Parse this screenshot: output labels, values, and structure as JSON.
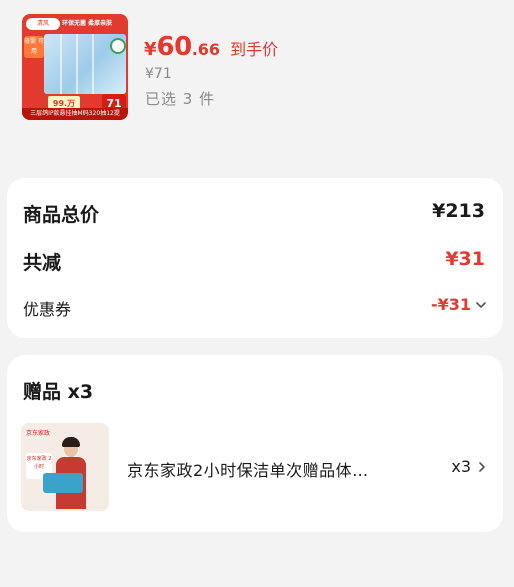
{
  "product": {
    "thumb": {
      "logo": "清风",
      "slogan": "环保无菌  柔厚亲肤",
      "badge": "母婴 可用",
      "price_a": "99.万",
      "price_b": "71",
      "bar_text": "三层鸽IP款悬挂抽M码320抽12提"
    },
    "price_symbol": "¥",
    "price_int": "60",
    "price_dec": ".66",
    "price_tag": "到手价",
    "original_price": "¥71",
    "selected_count": "已选 3 件"
  },
  "summary": {
    "total_label": "商品总价",
    "total_value": "¥213",
    "reduce_label": "共减",
    "reduce_value": "¥31",
    "coupon_label": "优惠券",
    "coupon_value": "-¥31"
  },
  "gifts": {
    "title": "赠品 x3",
    "items": [
      {
        "thumb_logo": "京东家政",
        "thumb_tag": "京东家政 2小时",
        "name": "京东家政2小时保洁单次赠品体…",
        "qty": "x3"
      }
    ]
  },
  "colors": {
    "accent_red": "#e4392c",
    "background": "#f3f3f4",
    "card": "#ffffff",
    "muted_text": "#8a8a8a"
  }
}
